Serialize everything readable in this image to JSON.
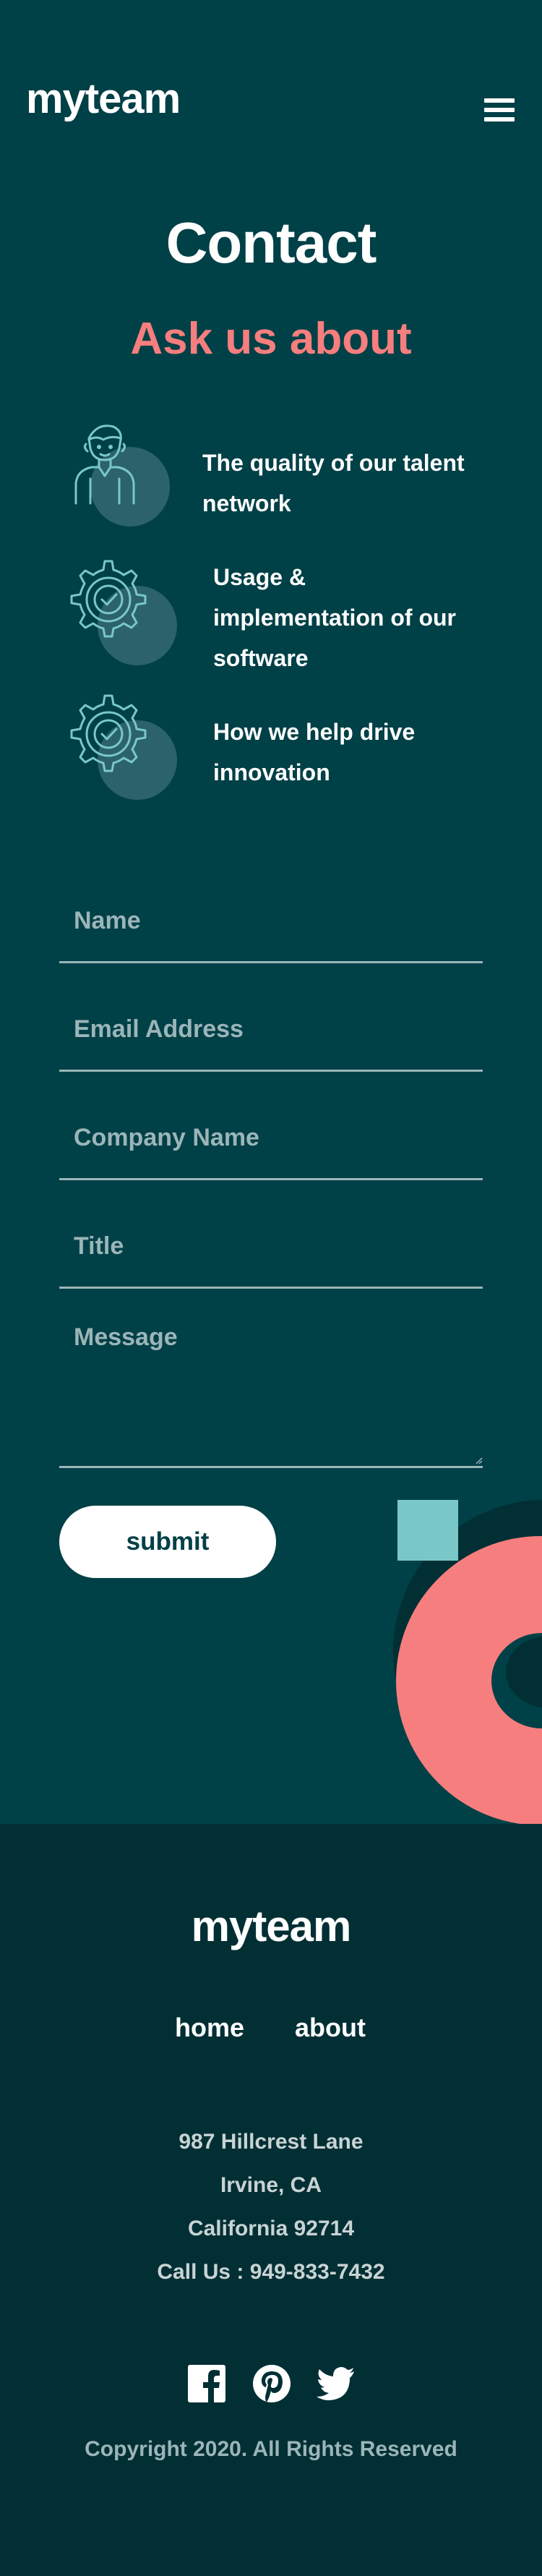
{
  "header": {
    "logo": "myteam",
    "menu_icon": "hamburger-menu-icon"
  },
  "hero": {
    "title": "Contact",
    "subtitle": "Ask us about"
  },
  "features": [
    {
      "icon": "person-icon",
      "text_lines": [
        "The quality of our talent",
        "network"
      ]
    },
    {
      "icon": "gear-check-icon",
      "text_lines": [
        "Usage &",
        "implementation of our",
        "software"
      ]
    },
    {
      "icon": "gear-check-icon",
      "text_lines": [
        "How we help drive",
        "innovation"
      ]
    }
  ],
  "form": {
    "name_placeholder": "Name",
    "email_placeholder": "Email Address",
    "company_placeholder": "Company Name",
    "title_placeholder": "Title",
    "message_placeholder": "Message",
    "submit_label": "submit"
  },
  "footer": {
    "logo": "myteam",
    "nav": {
      "home": "home",
      "about": "about"
    },
    "address": [
      "987 Hillcrest Lane",
      "Irvine, CA",
      "California 92714",
      "Call Us : 949-833-7432"
    ],
    "social": [
      "facebook-icon",
      "pinterest-icon",
      "twitter-icon"
    ],
    "copyright": "Copyright 2020. All Rights Reserved"
  },
  "colors": {
    "background": "#004047",
    "footer_background": "#012f34",
    "accent_coral": "#f67e7e",
    "accent_teal": "#79c8c7",
    "white": "#ffffff"
  }
}
